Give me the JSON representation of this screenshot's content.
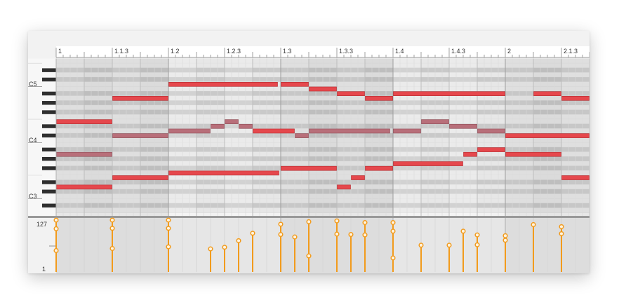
{
  "ruler": {
    "labels": [
      {
        "beat": 0,
        "text": "1"
      },
      {
        "beat": 2,
        "text": "1.1.3"
      },
      {
        "beat": 4,
        "text": "1.2"
      },
      {
        "beat": 6,
        "text": "1.2.3"
      },
      {
        "beat": 8,
        "text": "1.3"
      },
      {
        "beat": 10,
        "text": "1.3.3"
      },
      {
        "beat": 12,
        "text": "1.4"
      },
      {
        "beat": 14,
        "text": "1.4.3"
      },
      {
        "beat": 16,
        "text": "2"
      },
      {
        "beat": 18,
        "text": "2.1.3"
      }
    ]
  },
  "keyboard": {
    "top_pitch": 77,
    "bottom_pitch": 45,
    "octave_labels": [
      {
        "pitch": 72,
        "text": "C5"
      },
      {
        "pitch": 60,
        "text": "C4"
      },
      {
        "pitch": 48,
        "text": "C3"
      }
    ]
  },
  "colors": {
    "note_selected": "#e5484d",
    "note_muted": "#b86f7a",
    "velocity": "#f29b1c",
    "divider": "#999999"
  },
  "notes": [
    {
      "pitch": 72,
      "start": 4,
      "end": 7.9,
      "muted": false
    },
    {
      "pitch": 72,
      "start": 8,
      "end": 9,
      "muted": false
    },
    {
      "pitch": 71,
      "start": 9,
      "end": 10,
      "muted": false
    },
    {
      "pitch": 70,
      "start": 10,
      "end": 11,
      "muted": false
    },
    {
      "pitch": 70,
      "start": 12,
      "end": 16,
      "muted": false
    },
    {
      "pitch": 70,
      "start": 17,
      "end": 18,
      "muted": false
    },
    {
      "pitch": 69,
      "start": 2,
      "end": 4,
      "muted": false
    },
    {
      "pitch": 69,
      "start": 11,
      "end": 12,
      "muted": false
    },
    {
      "pitch": 69,
      "start": 18,
      "end": 19,
      "muted": false
    },
    {
      "pitch": 64,
      "start": 0,
      "end": 2,
      "muted": false
    },
    {
      "pitch": 64,
      "start": 6,
      "end": 6.5,
      "muted": true
    },
    {
      "pitch": 64,
      "start": 13,
      "end": 14,
      "muted": true
    },
    {
      "pitch": 63,
      "start": 5.5,
      "end": 6,
      "muted": true
    },
    {
      "pitch": 63,
      "start": 6.5,
      "end": 7,
      "muted": true
    },
    {
      "pitch": 63,
      "start": 14,
      "end": 15,
      "muted": true
    },
    {
      "pitch": 62,
      "start": 4,
      "end": 5.5,
      "muted": true
    },
    {
      "pitch": 62,
      "start": 7,
      "end": 8.5,
      "muted": false
    },
    {
      "pitch": 62,
      "start": 9,
      "end": 11.9,
      "muted": true
    },
    {
      "pitch": 62,
      "start": 12,
      "end": 13,
      "muted": true
    },
    {
      "pitch": 62,
      "start": 15,
      "end": 16,
      "muted": true
    },
    {
      "pitch": 61,
      "start": 2,
      "end": 4,
      "muted": true
    },
    {
      "pitch": 61,
      "start": 8.5,
      "end": 9,
      "muted": true
    },
    {
      "pitch": 61,
      "start": 16,
      "end": 19,
      "muted": false
    },
    {
      "pitch": 58,
      "start": 15,
      "end": 16,
      "muted": false
    },
    {
      "pitch": 57,
      "start": 0,
      "end": 2,
      "muted": true
    },
    {
      "pitch": 57,
      "start": 14.5,
      "end": 15,
      "muted": false
    },
    {
      "pitch": 57,
      "start": 16,
      "end": 18,
      "muted": false
    },
    {
      "pitch": 55,
      "start": 12,
      "end": 14.5,
      "muted": false
    },
    {
      "pitch": 54,
      "start": 8,
      "end": 10,
      "muted": false
    },
    {
      "pitch": 54,
      "start": 11,
      "end": 12,
      "muted": false
    },
    {
      "pitch": 53,
      "start": 4,
      "end": 7.95,
      "muted": false
    },
    {
      "pitch": 52,
      "start": 2,
      "end": 4,
      "muted": false
    },
    {
      "pitch": 52,
      "start": 10.5,
      "end": 11,
      "muted": false
    },
    {
      "pitch": 52,
      "start": 18,
      "end": 19,
      "muted": false
    },
    {
      "pitch": 50,
      "start": 0,
      "end": 2,
      "muted": false
    },
    {
      "pitch": 50,
      "start": 10,
      "end": 10.5,
      "muted": false
    }
  ],
  "velocity_lane": {
    "max_label": "127",
    "min_label": "1",
    "max": 127,
    "min": 1,
    "stems": [
      {
        "beat": 0,
        "values": [
          127,
          106,
          53
        ]
      },
      {
        "beat": 2,
        "values": [
          127,
          107,
          58
        ]
      },
      {
        "beat": 4,
        "values": [
          127,
          107,
          62
        ]
      },
      {
        "beat": 5.5,
        "values": [
          57
        ]
      },
      {
        "beat": 6,
        "values": [
          61
        ]
      },
      {
        "beat": 6.5,
        "values": [
          77
        ]
      },
      {
        "beat": 7,
        "values": [
          95
        ]
      },
      {
        "beat": 8,
        "values": [
          117,
          92
        ]
      },
      {
        "beat": 8.5,
        "values": [
          86
        ]
      },
      {
        "beat": 9,
        "values": [
          123,
          40
        ]
      },
      {
        "beat": 10,
        "values": [
          125,
          93
        ]
      },
      {
        "beat": 10.5,
        "values": [
          92
        ]
      },
      {
        "beat": 11,
        "values": [
          121,
          91
        ]
      },
      {
        "beat": 12,
        "values": [
          121,
          100,
          35
        ]
      },
      {
        "beat": 13,
        "values": [
          66
        ]
      },
      {
        "beat": 14,
        "values": [
          66
        ]
      },
      {
        "beat": 14.5,
        "values": [
          100
        ]
      },
      {
        "beat": 15,
        "values": [
          91,
          67
        ]
      },
      {
        "beat": 16,
        "values": [
          89,
          78
        ]
      },
      {
        "beat": 17,
        "values": [
          116
        ]
      },
      {
        "beat": 18,
        "values": [
          111,
          94
        ]
      }
    ]
  }
}
